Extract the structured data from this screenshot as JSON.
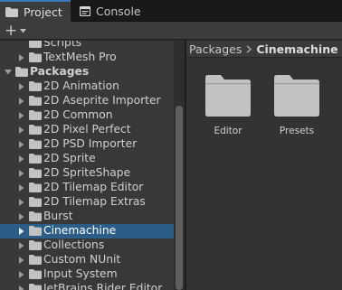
{
  "tabs": [
    {
      "label": "Project",
      "icon": "folder-icon",
      "active": true
    },
    {
      "label": "Console",
      "icon": "console-icon",
      "active": false
    }
  ],
  "toolbar": {
    "add_label": "+"
  },
  "tree": {
    "rows": [
      {
        "label": "Scripts",
        "has_arrow": false,
        "indent": 1
      },
      {
        "label": "TextMesh Pro",
        "has_arrow": true,
        "expanded": false,
        "indent": 1
      },
      {
        "label": "Packages",
        "has_arrow": true,
        "expanded": true,
        "indent": 0,
        "bold": true
      },
      {
        "label": "2D Animation",
        "has_arrow": true,
        "expanded": false,
        "indent": 1
      },
      {
        "label": "2D Aseprite Importer",
        "has_arrow": true,
        "expanded": false,
        "indent": 1
      },
      {
        "label": "2D Common",
        "has_arrow": true,
        "expanded": false,
        "indent": 1
      },
      {
        "label": "2D Pixel Perfect",
        "has_arrow": true,
        "expanded": false,
        "indent": 1
      },
      {
        "label": "2D PSD Importer",
        "has_arrow": true,
        "expanded": false,
        "indent": 1
      },
      {
        "label": "2D Sprite",
        "has_arrow": true,
        "expanded": false,
        "indent": 1
      },
      {
        "label": "2D SpriteShape",
        "has_arrow": true,
        "expanded": false,
        "indent": 1
      },
      {
        "label": "2D Tilemap Editor",
        "has_arrow": true,
        "expanded": false,
        "indent": 1
      },
      {
        "label": "2D Tilemap Extras",
        "has_arrow": true,
        "expanded": false,
        "indent": 1
      },
      {
        "label": "Burst",
        "has_arrow": true,
        "expanded": false,
        "indent": 1
      },
      {
        "label": "Cinemachine",
        "has_arrow": true,
        "expanded": false,
        "indent": 1,
        "selected": true
      },
      {
        "label": "Collections",
        "has_arrow": true,
        "expanded": false,
        "indent": 1
      },
      {
        "label": "Custom NUnit",
        "has_arrow": true,
        "expanded": false,
        "indent": 1
      },
      {
        "label": "Input System",
        "has_arrow": true,
        "expanded": false,
        "indent": 1
      },
      {
        "label": "JetBrains Rider Editor",
        "has_arrow": true,
        "expanded": false,
        "indent": 1
      }
    ]
  },
  "breadcrumb": {
    "parent": "Packages",
    "current": "Cinemachine"
  },
  "assets": [
    {
      "label": "Editor",
      "icon": "folder-icon"
    },
    {
      "label": "Presets",
      "icon": "folder-icon"
    }
  ],
  "colors": {
    "selection": "#2c5d87",
    "tab_accent": "#3a79bb",
    "folder": "#c2c2c2"
  }
}
